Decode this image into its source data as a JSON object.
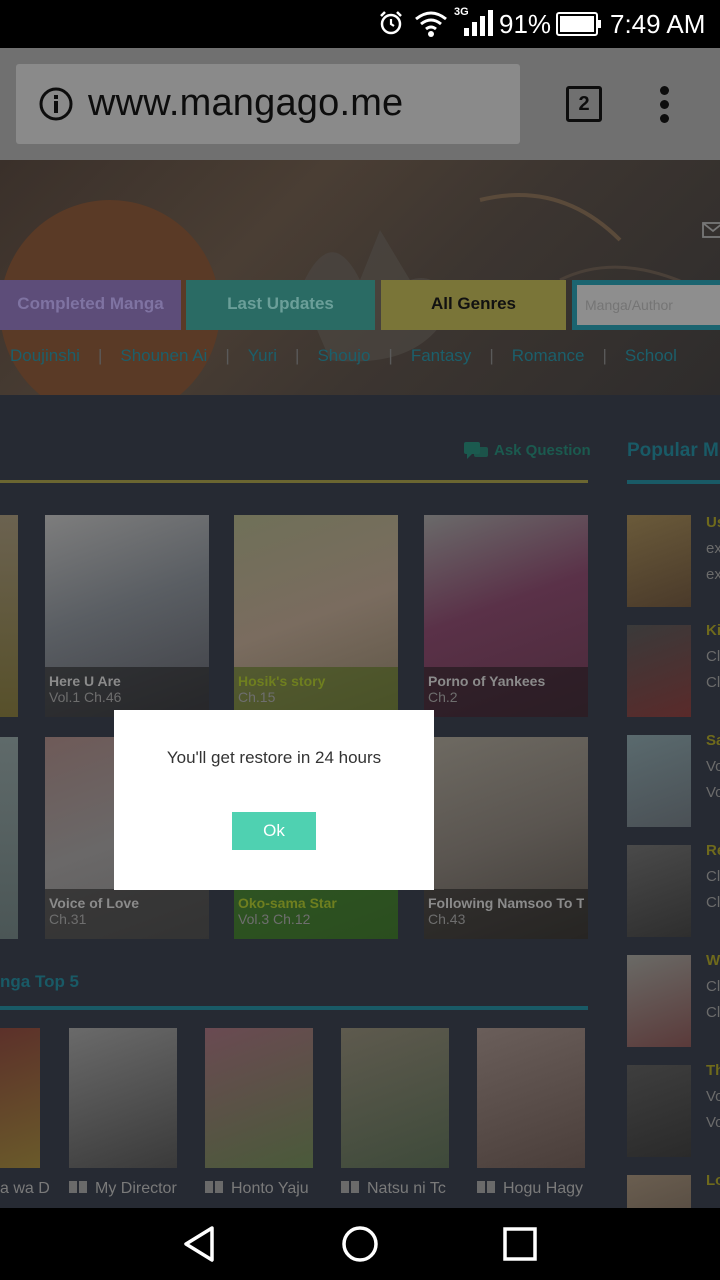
{
  "status_bar": {
    "network": "3G",
    "battery": "91%",
    "time": "7:49 AM",
    "icons": [
      "alarm-icon",
      "wifi-icon",
      "signal-icon",
      "battery-icon"
    ]
  },
  "browser": {
    "url": "www.mangago.me",
    "tab_count": "2",
    "icons": [
      "info-icon",
      "more-vert-icon"
    ]
  },
  "nav": {
    "completed": "Completed Manga",
    "updates": "Last Updates",
    "genres": "All Genres",
    "search_placeholder": "Manga/Author"
  },
  "genre_links": [
    "Doujinshi",
    "Shounen Ai",
    "Yuri",
    "Shoujo",
    "Fantasy",
    "Romance",
    "School"
  ],
  "ask_question": "Ask Question",
  "popular_title": "Popular M",
  "cards": [
    {
      "title": "Here U Are",
      "chapter": "Vol.1 Ch.46",
      "highlight": false
    },
    {
      "title": "Hosik's story",
      "chapter": "Ch.15",
      "highlight": true
    },
    {
      "title": "Porno of Yankees",
      "chapter": "Ch.2",
      "highlight": false
    },
    {
      "title": "Voice of Love",
      "chapter": "Ch.31",
      "highlight": false
    },
    {
      "title": "Oko-sama Star",
      "chapter": "Vol.3 Ch.12",
      "highlight": true
    },
    {
      "title": "Following Namsoo To T",
      "chapter": "Ch.43",
      "highlight": false
    }
  ],
  "top5_title": "nga Top 5",
  "top5": [
    {
      "label": "a wa D"
    },
    {
      "label": "My Director"
    },
    {
      "label": "Honto Yaju"
    },
    {
      "label": "Natsu ni Tc"
    },
    {
      "label": "Hogu Hagy"
    }
  ],
  "popular_items": [
    {
      "l1": "Us",
      "l2": "ex",
      "l3": "ex"
    },
    {
      "l1": "Ki",
      "l2": "Cl",
      "l3": "Cl"
    },
    {
      "l1": "Sa",
      "l2": "Vo",
      "l3": "Vo"
    },
    {
      "l1": "Re",
      "l2": "Cl",
      "l3": "Cl"
    },
    {
      "l1": "W",
      "l2": "Cl",
      "l3": "Cl"
    },
    {
      "l1": "Th",
      "l2": "Vo",
      "l3": "Vo"
    },
    {
      "l1": "Lo",
      "l2": "",
      "l3": ""
    }
  ],
  "dialog": {
    "message": "You'll get restore in 24 hours",
    "ok": "Ok"
  },
  "system_nav": [
    "back-icon",
    "home-icon",
    "recents-icon"
  ]
}
